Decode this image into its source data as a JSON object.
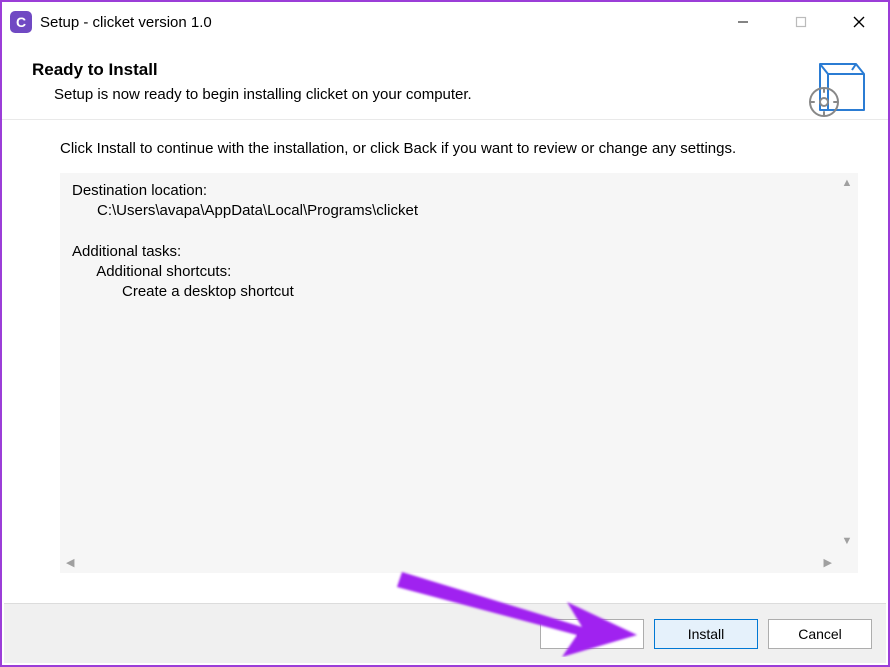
{
  "titlebar": {
    "app_icon_letter": "C",
    "title": "Setup - clicket version 1.0"
  },
  "header": {
    "title": "Ready to Install",
    "subtitle": "Setup is now ready to begin installing clicket on your computer."
  },
  "body": {
    "instruction": "Click Install to continue with the installation, or click Back if you want to review or change any settings.",
    "summary": {
      "dest_label": "Destination location:",
      "dest_path": "C:\\Users\\avapa\\AppData\\Local\\Programs\\clicket",
      "tasks_label": "Additional tasks:",
      "tasks_sub": "Additional shortcuts:",
      "tasks_item": "Create a desktop shortcut"
    }
  },
  "footer": {
    "back": "Back",
    "install": "Install",
    "cancel": "Cancel"
  }
}
